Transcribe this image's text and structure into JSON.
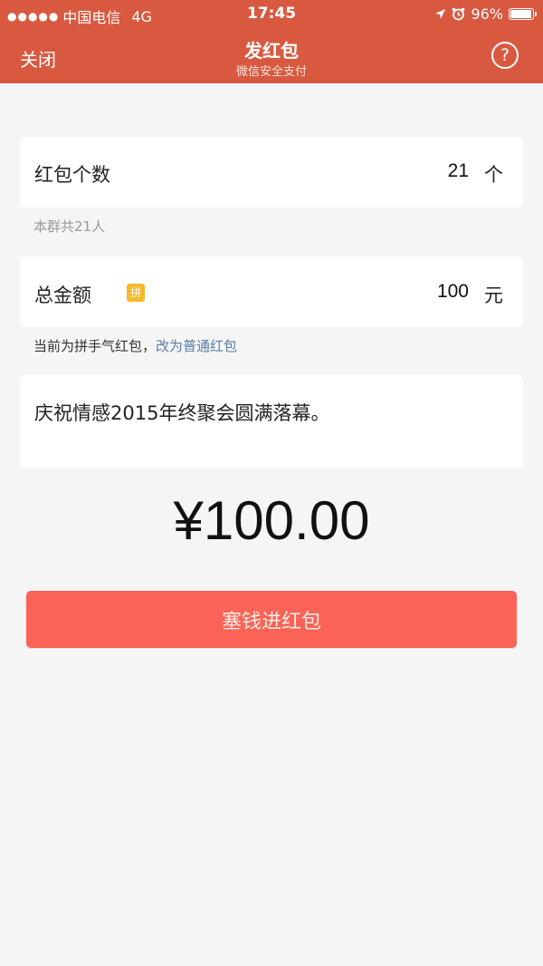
{
  "status_bar": {
    "signal_dots": "●●●●●",
    "carrier": "中国电信",
    "network": "4G",
    "time": "17:45",
    "battery_percent": "96%",
    "battery_level": 0.96,
    "icons": [
      "location-arrow-icon",
      "alarm-clock-icon",
      "battery-icon"
    ]
  },
  "nav": {
    "close_label": "关闭",
    "title": "发红包",
    "subtitle": "微信安全支付",
    "help_label": "?"
  },
  "count": {
    "label": "红包个数",
    "value": "21",
    "unit": "个",
    "hint": "本群共21人"
  },
  "amount": {
    "label": "总金额",
    "badge": "拼",
    "value": "100",
    "unit": "元",
    "hint_prefix": "当前为拼手气红包，",
    "hint_link": "改为普通红包"
  },
  "message": {
    "text": "庆祝情感2015年终聚会圆满落幕。"
  },
  "total": "¥100.00",
  "submit_label": "塞钱进红包",
  "colors": {
    "header": "#d85940",
    "submit": "#fa6355",
    "link": "#5b7fa8",
    "badge": "#f7b92c",
    "background": "#f5f5f5"
  }
}
